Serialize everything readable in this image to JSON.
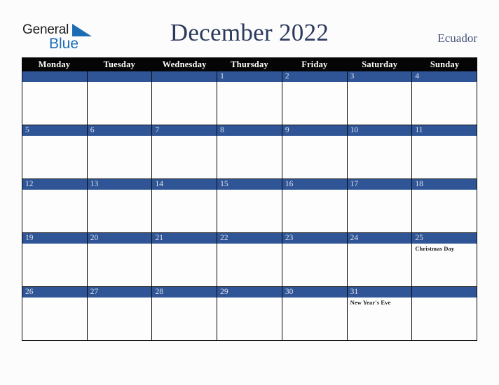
{
  "brand": {
    "logo_line1": "General",
    "logo_line2": "Blue",
    "triangle_icon": "blue-triangle-icon",
    "color_dark": "#1a1a1a",
    "color_blue": "#1c6cb5"
  },
  "header": {
    "title": "December 2022",
    "country": "Ecuador",
    "title_color": "#2b3a5c",
    "country_color": "#46557a"
  },
  "calendar": {
    "header_bg": "#050505",
    "daybar_bg": "#2f5597",
    "daynum_color": "#dfe3ec",
    "weekday_headers": [
      "Monday",
      "Tuesday",
      "Wednesday",
      "Thursday",
      "Friday",
      "Saturday",
      "Sunday"
    ],
    "weeks": [
      [
        {
          "date": "",
          "event": ""
        },
        {
          "date": "",
          "event": ""
        },
        {
          "date": "",
          "event": ""
        },
        {
          "date": "1",
          "event": ""
        },
        {
          "date": "2",
          "event": ""
        },
        {
          "date": "3",
          "event": ""
        },
        {
          "date": "4",
          "event": ""
        }
      ],
      [
        {
          "date": "5",
          "event": ""
        },
        {
          "date": "6",
          "event": ""
        },
        {
          "date": "7",
          "event": ""
        },
        {
          "date": "8",
          "event": ""
        },
        {
          "date": "9",
          "event": ""
        },
        {
          "date": "10",
          "event": ""
        },
        {
          "date": "11",
          "event": ""
        }
      ],
      [
        {
          "date": "12",
          "event": ""
        },
        {
          "date": "13",
          "event": ""
        },
        {
          "date": "14",
          "event": ""
        },
        {
          "date": "15",
          "event": ""
        },
        {
          "date": "16",
          "event": ""
        },
        {
          "date": "17",
          "event": ""
        },
        {
          "date": "18",
          "event": ""
        }
      ],
      [
        {
          "date": "19",
          "event": ""
        },
        {
          "date": "20",
          "event": ""
        },
        {
          "date": "21",
          "event": ""
        },
        {
          "date": "22",
          "event": ""
        },
        {
          "date": "23",
          "event": ""
        },
        {
          "date": "24",
          "event": ""
        },
        {
          "date": "25",
          "event": "Christmas Day"
        }
      ],
      [
        {
          "date": "26",
          "event": ""
        },
        {
          "date": "27",
          "event": ""
        },
        {
          "date": "28",
          "event": ""
        },
        {
          "date": "29",
          "event": ""
        },
        {
          "date": "30",
          "event": ""
        },
        {
          "date": "31",
          "event": "New Year's Eve"
        },
        {
          "date": "",
          "event": ""
        }
      ]
    ]
  }
}
